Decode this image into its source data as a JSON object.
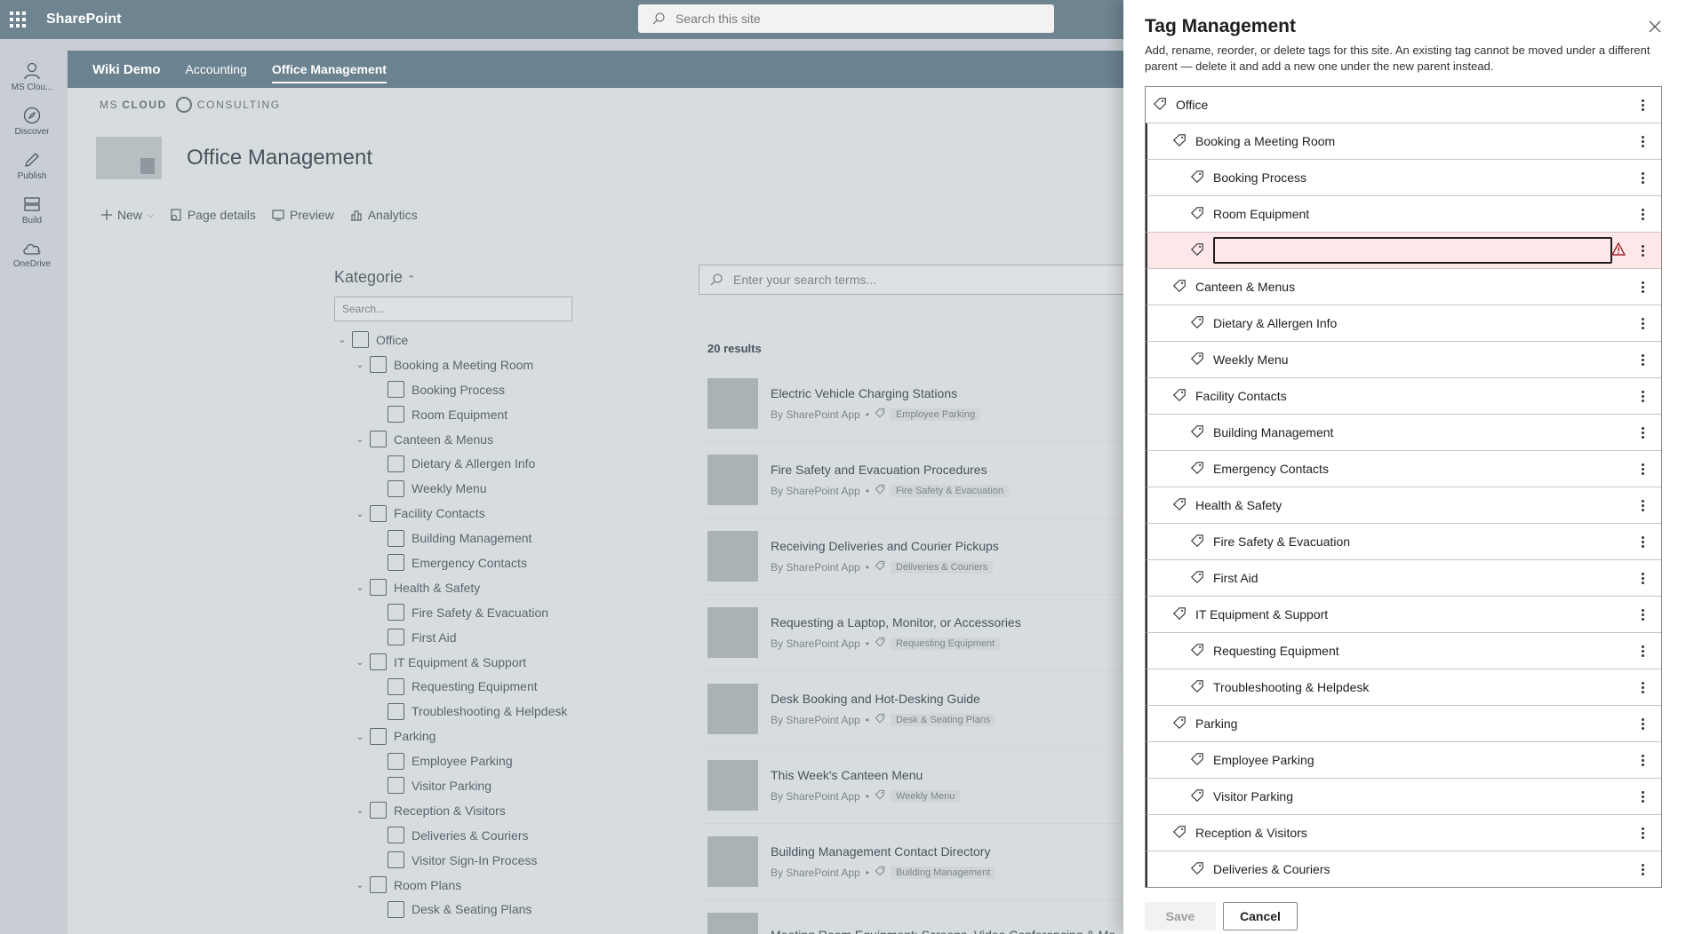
{
  "suitebar": {
    "brand": "SharePoint",
    "search_placeholder": "Search this site"
  },
  "appbar": [
    {
      "label": "MS Clou...",
      "icon": "profile-icon"
    },
    {
      "label": "Discover",
      "icon": "compass-icon"
    },
    {
      "label": "Publish",
      "icon": "pen-icon"
    },
    {
      "label": "Build",
      "icon": "build-icon"
    },
    {
      "label": "OneDrive",
      "icon": "cloud-icon"
    }
  ],
  "hubnav": {
    "items": [
      "Wiki Demo",
      "Accounting",
      "Office Management"
    ],
    "active": "Office Management"
  },
  "site": {
    "logo_left": "MS",
    "logo_bold": "CLOUD",
    "logo_right": "CONSULTING",
    "title": "Office Management",
    "commands": [
      "New",
      "Page details",
      "Preview",
      "Analytics"
    ]
  },
  "filter": {
    "title": "Kategorie",
    "search_placeholder": "Search...",
    "tree": [
      {
        "label": "Office",
        "level": 0
      },
      {
        "label": "Booking a Meeting Room",
        "level": 1
      },
      {
        "label": "Booking Process",
        "level": 2
      },
      {
        "label": "Room Equipment",
        "level": 2
      },
      {
        "label": "Canteen & Menus",
        "level": 1
      },
      {
        "label": "Dietary & Allergen Info",
        "level": 2
      },
      {
        "label": "Weekly Menu",
        "level": 2
      },
      {
        "label": "Facility Contacts",
        "level": 1
      },
      {
        "label": "Building Management",
        "level": 2
      },
      {
        "label": "Emergency Contacts",
        "level": 2
      },
      {
        "label": "Health & Safety",
        "level": 1
      },
      {
        "label": "Fire Safety & Evacuation",
        "level": 2
      },
      {
        "label": "First Aid",
        "level": 2
      },
      {
        "label": "IT Equipment & Support",
        "level": 1
      },
      {
        "label": "Requesting Equipment",
        "level": 2
      },
      {
        "label": "Troubleshooting & Helpdesk",
        "level": 2
      },
      {
        "label": "Parking",
        "level": 1
      },
      {
        "label": "Employee Parking",
        "level": 2
      },
      {
        "label": "Visitor Parking",
        "level": 2
      },
      {
        "label": "Reception & Visitors",
        "level": 1
      },
      {
        "label": "Deliveries & Couriers",
        "level": 2
      },
      {
        "label": "Visitor Sign-In Process",
        "level": 2
      },
      {
        "label": "Room Plans",
        "level": 1
      },
      {
        "label": "Desk & Seating Plans",
        "level": 2
      }
    ]
  },
  "results": {
    "search_placeholder": "Enter your search terms...",
    "count": "20 results",
    "items": [
      {
        "title": "Electric Vehicle Charging Stations",
        "by": "By SharePoint App",
        "tag": "Employee Parking"
      },
      {
        "title": "Fire Safety and Evacuation Procedures",
        "by": "By SharePoint App",
        "tag": "Fire Safety & Evacuation"
      },
      {
        "title": "Receiving Deliveries and Courier Pickups",
        "by": "By SharePoint App",
        "tag": "Deliveries & Couriers"
      },
      {
        "title": "Requesting a Laptop, Monitor, or Accessories",
        "by": "By SharePoint App",
        "tag": "Requesting Equipment"
      },
      {
        "title": "Desk Booking and Hot-Desking Guide",
        "by": "By SharePoint App",
        "tag": "Desk & Seating Plans"
      },
      {
        "title": "This Week's Canteen Menu",
        "by": "By SharePoint App",
        "tag": "Weekly Menu"
      },
      {
        "title": "Building Management Contact Directory",
        "by": "By SharePoint App",
        "tag": "Building Management"
      },
      {
        "title": "Meeting Room Equipment: Screens, Video Conferencing & Mo",
        "by": "",
        "tag": ""
      }
    ]
  },
  "panel": {
    "title": "Tag Management",
    "description": "Add, rename, reorder, or delete tags for this site. An existing tag cannot be moved under a different parent — delete it and add a new one under the new parent instead.",
    "tags": [
      {
        "label": "Office",
        "level": 0
      },
      {
        "label": "Booking a Meeting Room",
        "level": 1
      },
      {
        "label": "Booking Process",
        "level": 2
      },
      {
        "label": "Room Equipment",
        "level": 2
      },
      {
        "label": "",
        "level": 2,
        "editing": true,
        "value": ""
      },
      {
        "label": "Canteen & Menus",
        "level": 1
      },
      {
        "label": "Dietary & Allergen Info",
        "level": 2
      },
      {
        "label": "Weekly Menu",
        "level": 2
      },
      {
        "label": "Facility Contacts",
        "level": 1
      },
      {
        "label": "Building Management",
        "level": 2
      },
      {
        "label": "Emergency Contacts",
        "level": 2
      },
      {
        "label": "Health & Safety",
        "level": 1
      },
      {
        "label": "Fire Safety & Evacuation",
        "level": 2
      },
      {
        "label": "First Aid",
        "level": 2
      },
      {
        "label": "IT Equipment & Support",
        "level": 1
      },
      {
        "label": "Requesting Equipment",
        "level": 2
      },
      {
        "label": "Troubleshooting & Helpdesk",
        "level": 2
      },
      {
        "label": "Parking",
        "level": 1
      },
      {
        "label": "Employee Parking",
        "level": 2
      },
      {
        "label": "Visitor Parking",
        "level": 2
      },
      {
        "label": "Reception & Visitors",
        "level": 1
      },
      {
        "label": "Deliveries & Couriers",
        "level": 2
      }
    ],
    "save_label": "Save",
    "cancel_label": "Cancel",
    "error_color": "#a4262c"
  }
}
